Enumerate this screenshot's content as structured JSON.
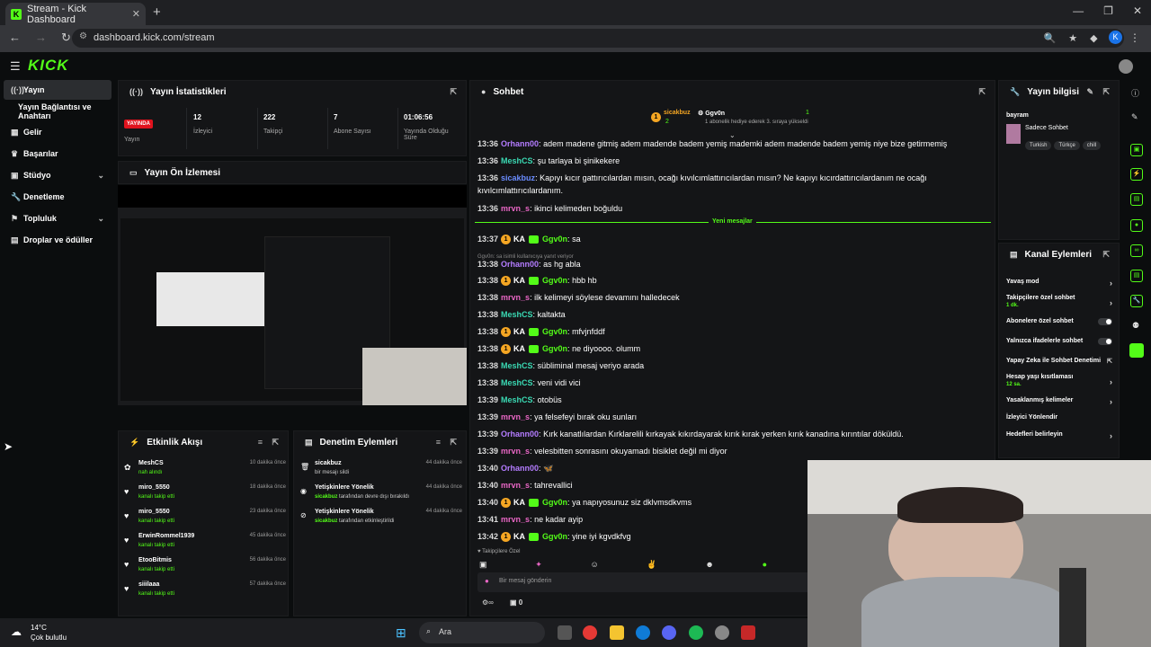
{
  "browser": {
    "tab_title": "Stream - Kick Dashboard",
    "url": "dashboard.kick.com/stream",
    "profile_initial": "K"
  },
  "brand": {
    "logo": "KICK",
    "accent": "#53fc18"
  },
  "sidebar": {
    "items": [
      {
        "label": "Yayın",
        "icon": "broadcast-icon"
      },
      {
        "label": "Yayın Bağlantısı ve Anahtarı"
      },
      {
        "label": "Gelir",
        "icon": "revenue-icon"
      },
      {
        "label": "Başarılar",
        "icon": "trophy-icon"
      },
      {
        "label": "Stüdyo",
        "icon": "studio-icon"
      },
      {
        "label": "Denetleme",
        "icon": "wrench-icon"
      },
      {
        "label": "Topluluk",
        "icon": "community-icon"
      },
      {
        "label": "Droplar ve ödüller",
        "icon": "drops-icon"
      }
    ]
  },
  "stats": {
    "title": "Yayın İstatistikleri",
    "live_badge": "YAYINDA",
    "items": [
      {
        "label": "Yayın",
        "value": ""
      },
      {
        "label": "İzleyici",
        "value": "12"
      },
      {
        "label": "Takipçi",
        "value": "222"
      },
      {
        "label": "Abone Sayısı",
        "value": "7"
      },
      {
        "label": "Yayında Olduğu Süre",
        "value": "01:06:56"
      }
    ]
  },
  "preview": {
    "title": "Yayın Ön İzlemesi"
  },
  "events": {
    "title": "Etkinlik Akışı",
    "items": [
      {
        "name": "MeshCS",
        "desc": "nah alındı",
        "time": "10 dakika önce"
      },
      {
        "name": "miro_5550",
        "desc": "kanalı takip etti",
        "time": "18 dakika önce"
      },
      {
        "name": "miro_5550",
        "desc": "kanalı takip etti",
        "time": "23 dakika önce"
      },
      {
        "name": "ErwinRommel1939",
        "desc": "kanalı takip etti",
        "time": "45 dakika önce"
      },
      {
        "name": "EtooBitmis",
        "desc": "kanalı takip etti",
        "time": "56 dakika önce"
      },
      {
        "name": "siiilaaa",
        "desc": "kanalı takip etti",
        "time": "57 dakika önce"
      }
    ]
  },
  "moderation": {
    "title": "Denetim Eylemleri",
    "items": [
      {
        "name": "sicakbuz",
        "desc_pre": "",
        "desc_user": "",
        "desc": "bir mesajı sildi",
        "time": "44 dakika önce"
      },
      {
        "name": "Yetişkinlere Yönelik",
        "desc_user": "sicakbuz",
        "desc": " tarafından devre dışı bırakıldı",
        "time": "44 dakika önce"
      },
      {
        "name": "Yetişkinlere Yönelik",
        "desc_user": "sicakbuz",
        "desc": " tarafından etkinleştirildi",
        "time": "44 dakika önce"
      }
    ]
  },
  "chat": {
    "title": "Sohbet",
    "pinned": {
      "user1": "sicakbuz",
      "count1": "2",
      "user2": "Ggv0n",
      "note": "1 abonelik hediye ederek 3. sıraya yükseldi",
      "count2": "1"
    },
    "new_messages_label": "Yeni mesajlar",
    "messages": [
      {
        "time": "13:36",
        "user": "Orhann00",
        "color": "purple",
        "text": "adem madene gitmiş adem madende badem yemiş mademki adem madende badem yemiş niye bize getirmemiş"
      },
      {
        "time": "13:36",
        "user": "MeshCS",
        "color": "teal",
        "text": "şu tarlaya bi şinikekere"
      },
      {
        "time": "13:36",
        "user": "sicakbuz",
        "color": "blue",
        "text": "Kapıyı kıcır gattırıcılardan mısın, ocağı kıvılcımlattırıcılardan mısın? Ne kapıyı kıcırdattırıcılardanım ne ocağı kıvılcımlattırıcılardanım."
      },
      {
        "time": "13:36",
        "user": "mrvn_s",
        "color": "pink",
        "text": "ikinci kelimeden boğuldu"
      },
      {
        "time": "13:37",
        "user": "Ggv0n",
        "color": "green",
        "badge": "KA",
        "text": "sa"
      },
      {
        "time": "13:38",
        "user": "Orhann00",
        "color": "purple",
        "text": "as hg abla",
        "reply": "Ggv0n: sa isimli kullanıcıya yanıt veriyor"
      },
      {
        "time": "13:38",
        "user": "Ggv0n",
        "color": "green",
        "badge": "KA",
        "text": "hbb hb"
      },
      {
        "time": "13:38",
        "user": "mrvn_s",
        "color": "pink",
        "text": "ilk kelimeyi söylese devamını halledecek"
      },
      {
        "time": "13:38",
        "user": "MeshCS",
        "color": "teal",
        "text": "kaltakta"
      },
      {
        "time": "13:38",
        "user": "Ggv0n",
        "color": "green",
        "badge": "KA",
        "text": "mfvjnfddf"
      },
      {
        "time": "13:38",
        "user": "Ggv0n",
        "color": "green",
        "badge": "KA",
        "text": "ne diyoooo. olumm"
      },
      {
        "time": "13:38",
        "user": "MeshCS",
        "color": "teal",
        "text": "sübliminal mesaj veriyo arada"
      },
      {
        "time": "13:38",
        "user": "MeshCS",
        "color": "teal",
        "text": "veni vidi vici"
      },
      {
        "time": "13:39",
        "user": "MeshCS",
        "color": "teal",
        "text": "otobüs"
      },
      {
        "time": "13:39",
        "user": "mrvn_s",
        "color": "pink",
        "text": "ya felsefeyi bırak oku sunları"
      },
      {
        "time": "13:39",
        "user": "Orhann00",
        "color": "purple",
        "text": "Kırk kanatlılardan Kırklarelili kırkayak kıkırdayarak kırık kırak yerken kırık kanadına kırıntılar döküldü."
      },
      {
        "time": "13:39",
        "user": "mrvn_s",
        "color": "pink",
        "text": "velesbitten sonrasını okuyamadı bisiklet değil mi diyor"
      },
      {
        "time": "13:40",
        "user": "Orhann00",
        "color": "purple",
        "text": "🦋"
      },
      {
        "time": "13:40",
        "user": "mrvn_s",
        "color": "pink",
        "text": "tahrevallici"
      },
      {
        "time": "13:40",
        "user": "Ggv0n",
        "color": "green",
        "badge": "KA",
        "text": "ya napıyosunuz siz dklvmsdkvms"
      },
      {
        "time": "13:41",
        "user": "mrvn_s",
        "color": "pink",
        "text": "ne kadar ayip"
      },
      {
        "time": "13:42",
        "user": "Ggv0n",
        "color": "green",
        "badge": "KA",
        "text": "yine iyi kgvdkfvg"
      }
    ],
    "followers_only": "Takipçilere Özel",
    "input_placeholder": "Bir mesaj gönderin",
    "footer_count": "0"
  },
  "stream_info": {
    "title": "Yayın bilgisi",
    "category": "bayram",
    "subtitle": "Sadece Sohbet",
    "tags": [
      "Turkish",
      "Türkçe",
      "chill"
    ]
  },
  "channel_actions": {
    "title": "Kanal Eylemleri",
    "items": [
      {
        "label": "Yavaş mod",
        "kind": "chevron"
      },
      {
        "label": "Takipçilere özel sohbet",
        "sub": "1 dk.",
        "kind": "chevron"
      },
      {
        "label": "Abonelere özel sohbet",
        "kind": "toggle"
      },
      {
        "label": "Yalnızca ifadelerle sohbet",
        "kind": "toggle"
      },
      {
        "label": "Yapay Zeka ile Sohbet Denetimi",
        "kind": "link"
      },
      {
        "label": "Hesap yaşı kısıtlaması",
        "sub": "12 sa.",
        "kind": "chevron"
      },
      {
        "label": "Yasaklanmış kelimeler",
        "kind": "chevron"
      },
      {
        "label": "İzleyici Yönlendir",
        "kind": "none"
      },
      {
        "label": "Hedefleri belirleyin",
        "kind": "chevron"
      }
    ]
  },
  "taskbar": {
    "temp": "14°C",
    "weather": "Çok bulutlu",
    "search": "Ara"
  }
}
